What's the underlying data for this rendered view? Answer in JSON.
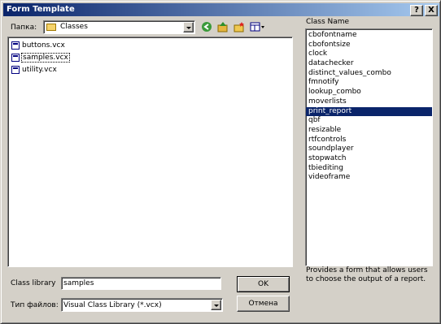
{
  "window": {
    "title": "Form Template"
  },
  "titlebar": {
    "help": "?",
    "close": "X"
  },
  "folder": {
    "label": "Папка:",
    "current": "Classes"
  },
  "files": [
    {
      "name": "buttons.vcx",
      "selected": false
    },
    {
      "name": "samples.vcx",
      "selected": true
    },
    {
      "name": "utility.vcx",
      "selected": false
    }
  ],
  "classes": {
    "header": "Class Name",
    "items": [
      "cbofontname",
      "cbofontsize",
      "clock",
      "datachecker",
      "distinct_values_combo",
      "fmnotify",
      "lookup_combo",
      "moverlists",
      "print_report",
      "qbf",
      "resizable",
      "rtfcontrols",
      "soundplayer",
      "stopwatch",
      "tbiediting",
      "videoframe"
    ],
    "selected_index": 8,
    "description": "Provides a form that allows users to choose the output of a report."
  },
  "form": {
    "class_library_label": "Class library",
    "class_library_value": "samples",
    "file_type_label": "Тип файлов:",
    "file_type_value": "Visual Class Library (*.vcx)"
  },
  "buttons": {
    "ok": "OK",
    "cancel": "Отмена"
  },
  "colors": {
    "title_start": "#0a246a",
    "title_end": "#a6caf0",
    "selection": "#0a246a"
  }
}
